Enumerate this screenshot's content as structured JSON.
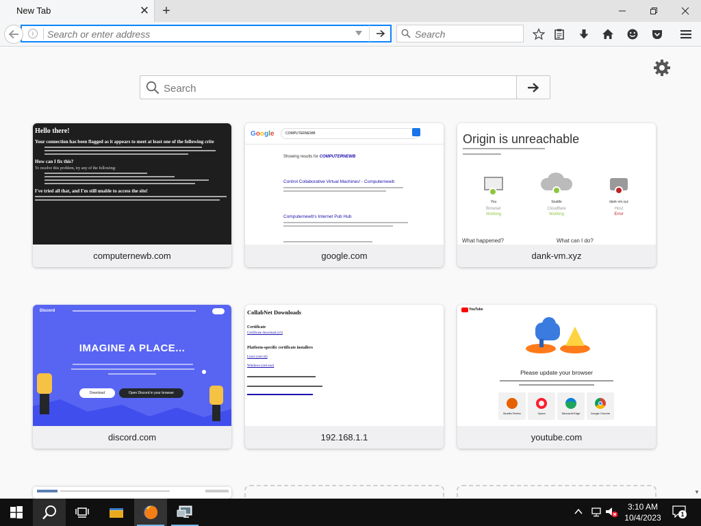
{
  "browser": {
    "tab": {
      "title": "New Tab"
    },
    "urlbar": {
      "placeholder": "Search or enter address"
    },
    "searchbar": {
      "placeholder": "Search"
    }
  },
  "newtab": {
    "search": {
      "placeholder": "Search"
    },
    "tiles": [
      {
        "label": "computernewb.com"
      },
      {
        "label": "google.com"
      },
      {
        "label": "dank-vm.xyz"
      },
      {
        "label": "discord.com"
      },
      {
        "label": "192.168.1.1"
      },
      {
        "label": "youtube.com"
      }
    ],
    "thumbs": {
      "computernewb": {
        "heading": "Hello there!",
        "flagged": "Your connection has been flagged as it appears to meet at least one of the following crite",
        "fix_heading": "How can I fix this?",
        "fix_text": "To resolve this problem, try any of the following:",
        "tried_heading": "I've tried all that, and I'm still unable to access the site!"
      },
      "google": {
        "query": "COMPUTERNEWB",
        "results_prefix": "Showing results for",
        "results_term": "COMPUTERNEWB",
        "result1": "Control Collaborative Virtual Machines! - Computernewb",
        "result2": "Computernewb's Internet Pub Hub"
      },
      "dank": {
        "title": "Origin is unreachable",
        "node1": "You",
        "node1_sub": "Browser",
        "node1_status": "Working",
        "node2": "Seattle",
        "node2_sub": "Cloudflare",
        "node2_status": "Working",
        "node3": "dank-vm.xyz",
        "node3_sub": "Host",
        "node3_status": "Error",
        "q1": "What happened?",
        "q2": "What can I do?"
      },
      "discord": {
        "logo": "Discord",
        "headline": "IMAGINE A PLACE...",
        "download": "Download",
        "open": "Open Discord in your browser"
      },
      "collab": {
        "title": "CollabNet Downloads",
        "cert_heading": "Certificate",
        "cert_link": "Certificate download (crt)",
        "platform_heading": "Platform-specific certificate installers",
        "link1": "Linux (cert.sh)",
        "link2": "Windows (cert.exe)"
      },
      "youtube": {
        "brand": "YouTube",
        "headline": "Please update your browser",
        "browsers": [
          "Mozilla Firefox",
          "Opera",
          "Microsoft Edge",
          "Google Chrome"
        ]
      }
    }
  },
  "taskbar": {
    "time": "3:10 AM",
    "date": "10/4/2023",
    "notification_count": "1"
  },
  "colors": {
    "accent": "#0a84ff",
    "taskbar": "#101010",
    "discord": "#5865f2"
  }
}
